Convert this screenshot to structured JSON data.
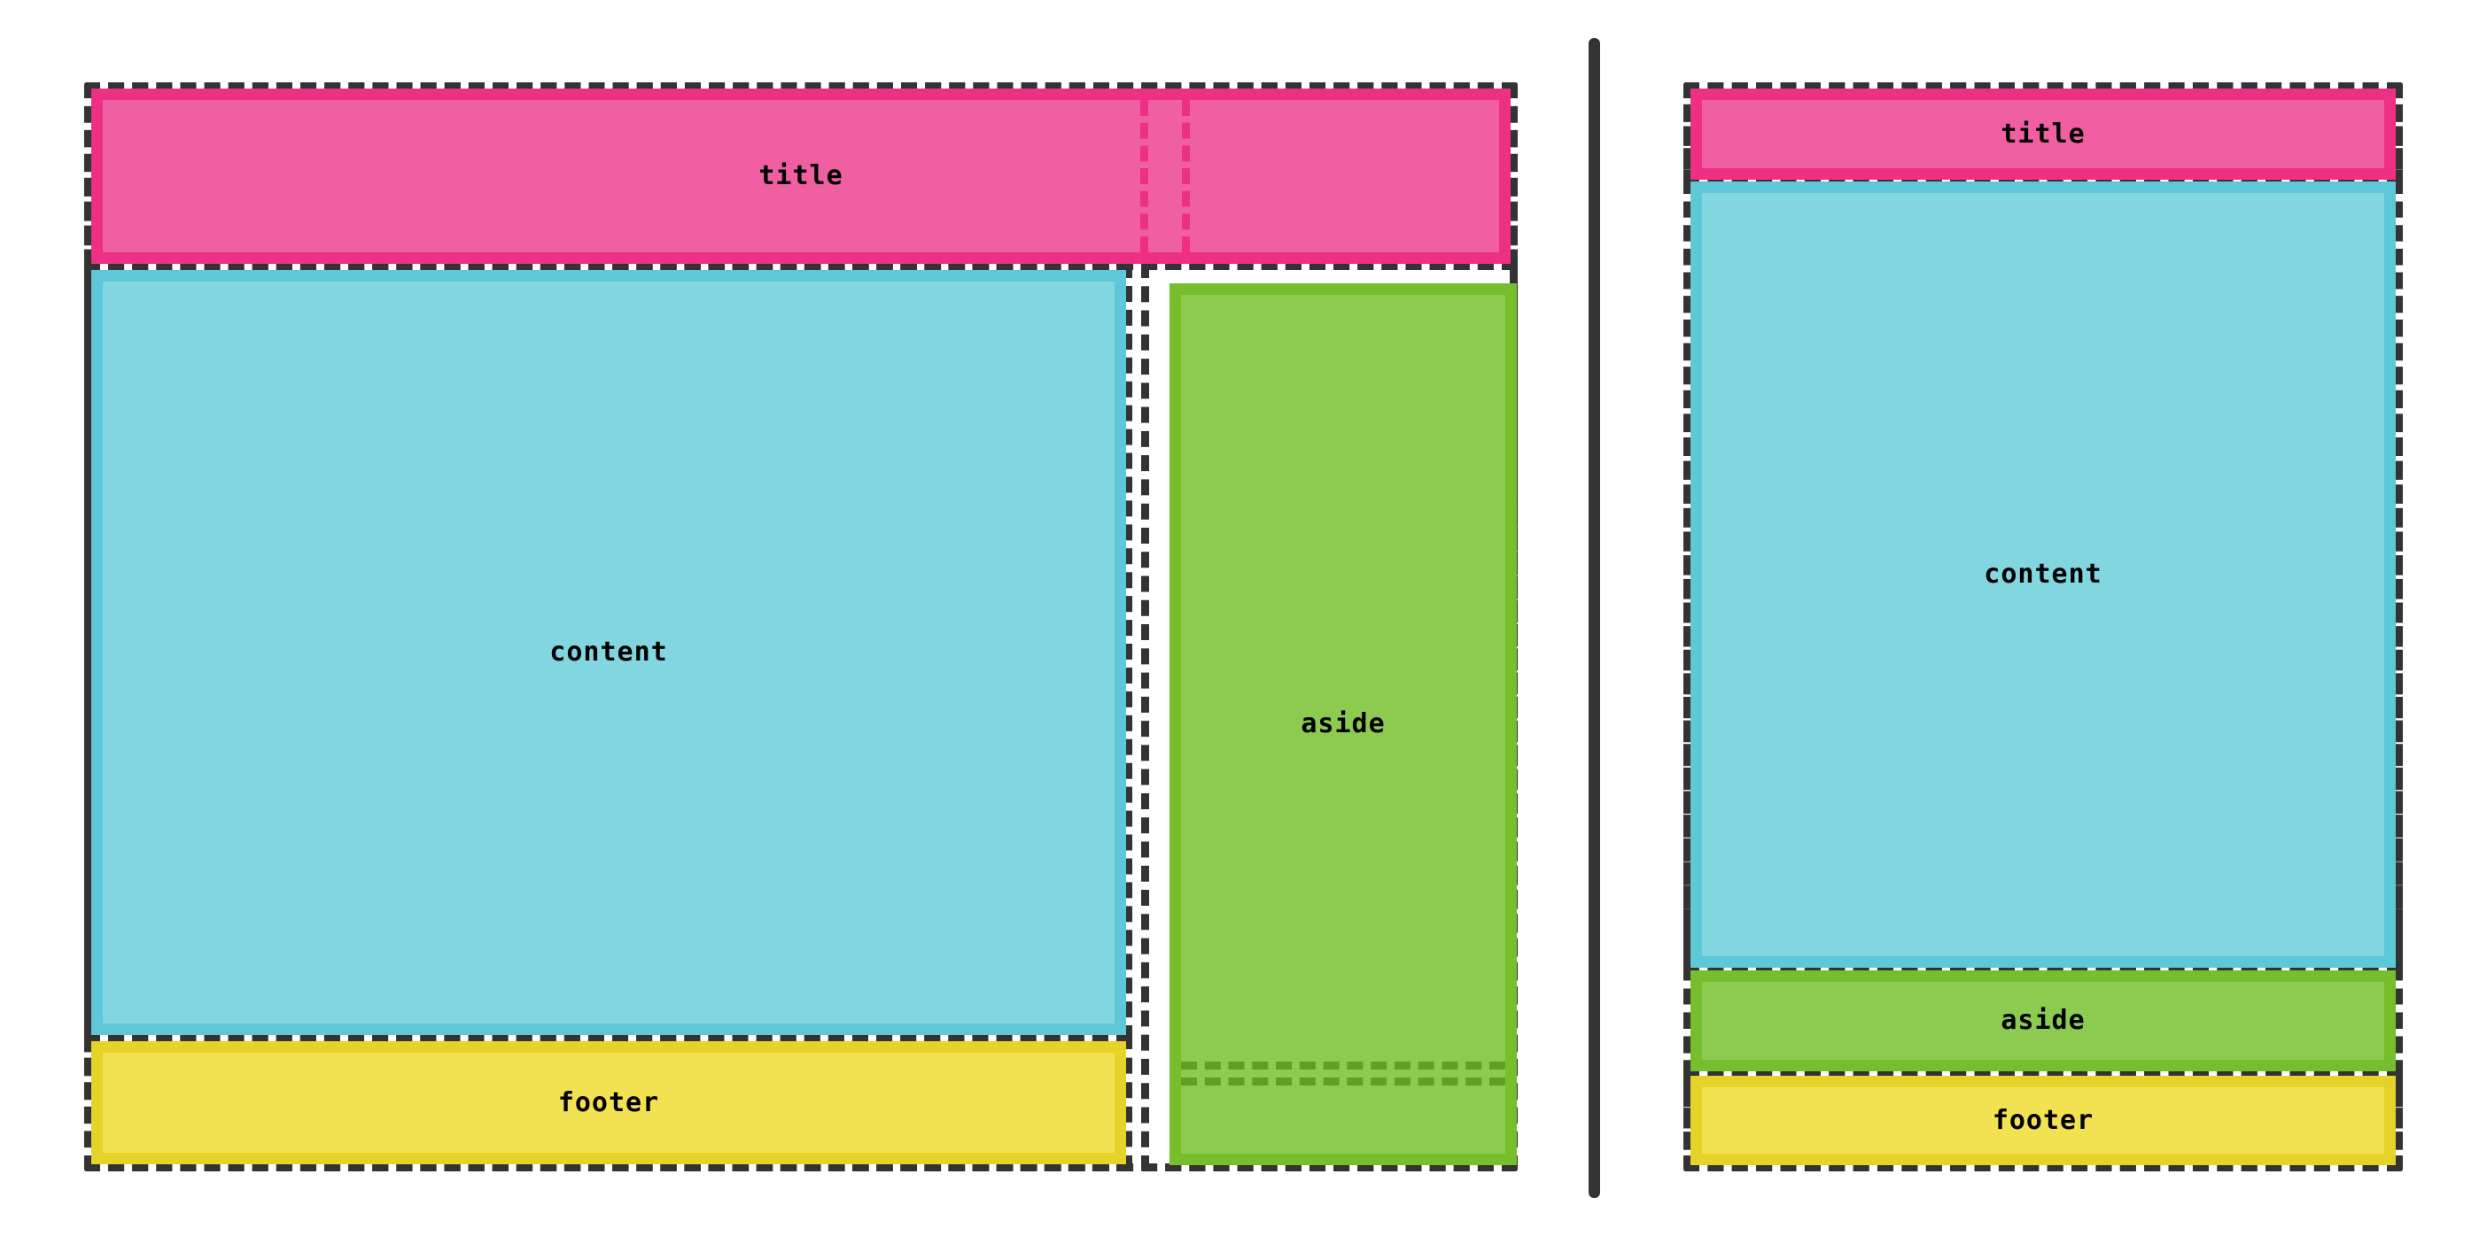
{
  "diagram": {
    "kind": "css-grid-layout-illustration",
    "panel_count": 2,
    "colors": {
      "outline": "#333333",
      "title_fill": "#F05FA2",
      "title_border": "#EE3084",
      "content_fill": "#81D6E0",
      "content_border": "#5FC8D8",
      "aside_fill": "#8CCA50",
      "aside_border": "#76BE2C",
      "aside_gutter_dash": "#5F9F28",
      "footer_fill": "#F2E252",
      "footer_border": "#E6D32A",
      "background": "#FFFFFF"
    },
    "separator": {
      "orientation": "vertical"
    },
    "panels": [
      {
        "id": "wide-layout",
        "areas": {
          "title": {
            "label": "title"
          },
          "content": {
            "label": "content"
          },
          "aside": {
            "label": "aside"
          },
          "footer": {
            "label": "footer"
          }
        },
        "gutter_marks": {
          "title_column_gutter": 2,
          "aside_row_gutter": 2
        }
      },
      {
        "id": "stacked-layout",
        "areas": {
          "title": {
            "label": "title"
          },
          "content": {
            "label": "content"
          },
          "aside": {
            "label": "aside"
          },
          "footer": {
            "label": "footer"
          }
        },
        "gutter_marks": {
          "title_column_gutter": 0,
          "aside_row_gutter": 0
        }
      }
    ]
  }
}
